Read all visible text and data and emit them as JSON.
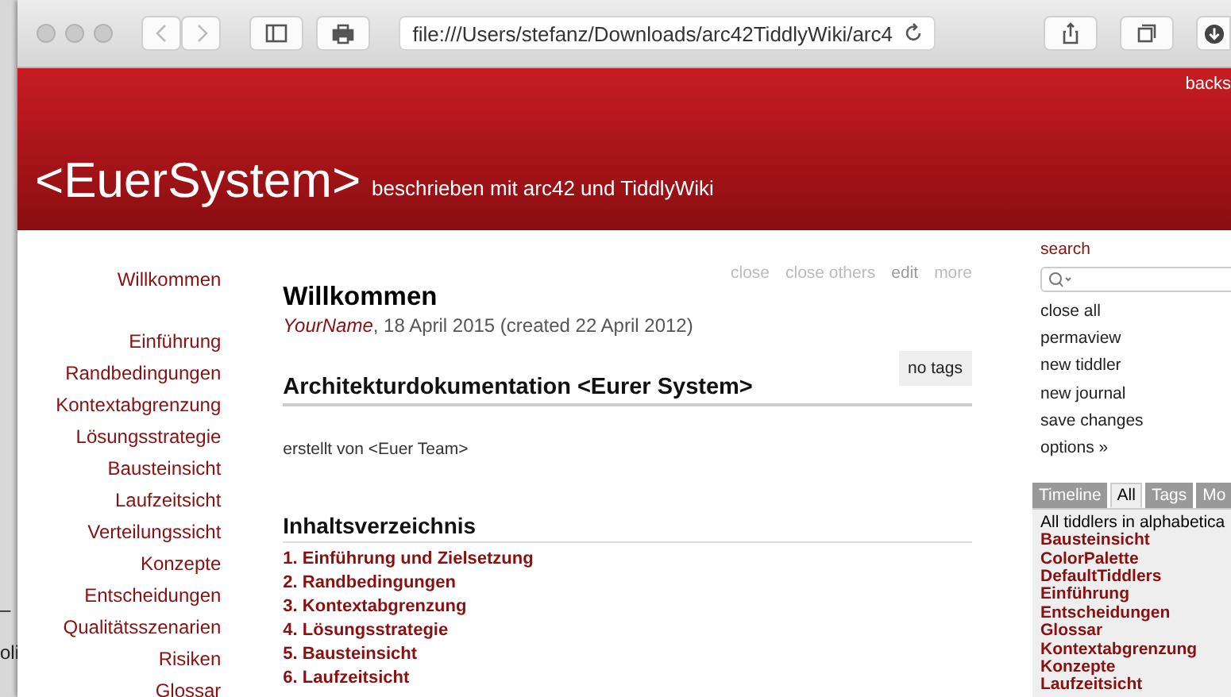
{
  "background_texts": [
    "–",
    "oli"
  ],
  "browser": {
    "url": "file:///Users/stefanz/Downloads/arc42TiddlyWiki/arc4"
  },
  "header": {
    "corner_link": "backs",
    "site_title": "<EuerSystem>",
    "subtitle": "beschrieben mit arc42 und TiddlyWiki"
  },
  "main_menu": {
    "home": "Willkommen",
    "items": [
      "Einführung",
      "Randbedingungen",
      "Kontextabgrenzung",
      "Lösungsstrategie",
      "Bausteinsicht",
      "Laufzeitsicht",
      "Verteilungssicht",
      "Konzepte",
      "Entscheidungen",
      "Qualitätsszenarien",
      "Risiken",
      "Glossar"
    ]
  },
  "tiddler": {
    "toolbar": [
      {
        "label": "close",
        "kind": "plain"
      },
      {
        "label": "close others",
        "kind": "plain"
      },
      {
        "label": "edit",
        "kind": "strong"
      },
      {
        "label": "more",
        "kind": "plain"
      }
    ],
    "title": "Willkommen",
    "author": "YourName",
    "date": ", 18 April 2015 (created 22 April 2012)",
    "tags": "no tags",
    "heading": "Architekturdokumentation <Eurer System>",
    "byline": "erstellt von <Euer Team>",
    "toc_heading": "Inhaltsverzeichnis",
    "toc": [
      "1. Einführung und Zielsetzung",
      "2. Randbedingungen",
      "3. Kontextabgrenzung",
      "4. Lösungsstrategie",
      "5. Bausteinsicht",
      "6. Laufzeitsicht"
    ]
  },
  "sidebar": {
    "search_label": "search",
    "options": [
      "close all",
      "permaview",
      "new tiddler",
      "new journal",
      "save changes",
      "options »"
    ],
    "tabs": [
      {
        "label": "Timeline",
        "selected": false
      },
      {
        "label": "All",
        "selected": true
      },
      {
        "label": "Tags",
        "selected": false
      },
      {
        "label": "Mo",
        "selected": false
      }
    ],
    "list_caption": "All tiddlers in alphabetica",
    "list": [
      "Bausteinsicht",
      "ColorPalette",
      "DefaultTiddlers",
      "Einführung",
      "Entscheidungen",
      "Glossar",
      "Kontextabgrenzung",
      "Konzepte",
      "Laufzeitsicht"
    ]
  }
}
